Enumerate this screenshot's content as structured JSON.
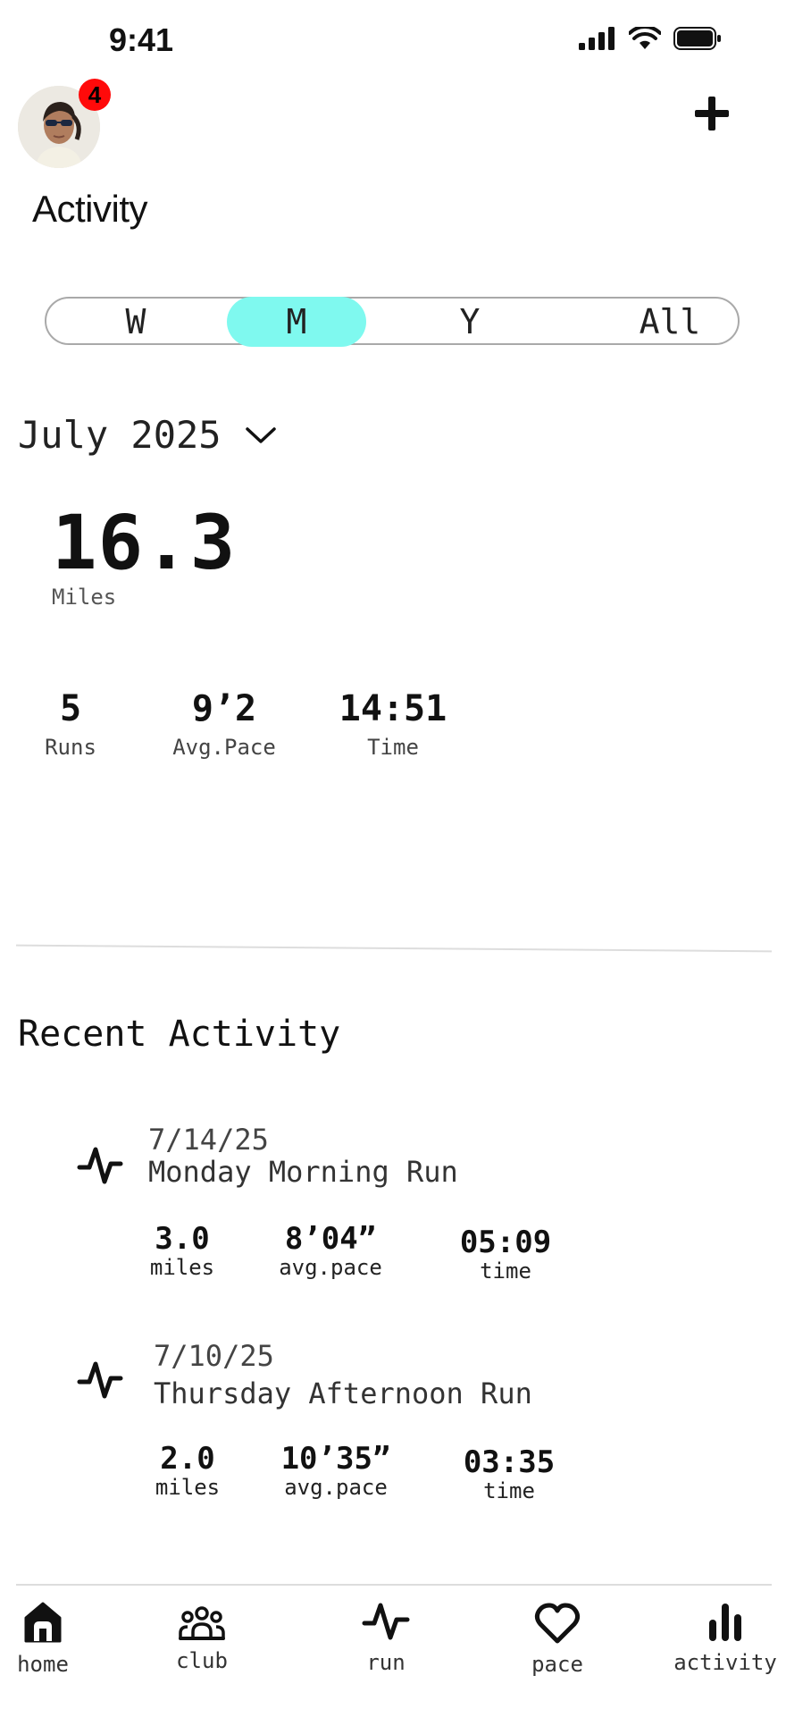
{
  "status": {
    "time": "9:41"
  },
  "header": {
    "badge_count": "4",
    "title": "Activity"
  },
  "segments": [
    {
      "label": "W",
      "selected": false
    },
    {
      "label": "M",
      "selected": true
    },
    {
      "label": "Y",
      "selected": false
    },
    {
      "label": "All",
      "selected": false
    }
  ],
  "period": {
    "label": "July 2025"
  },
  "summary": {
    "value": "16.3",
    "unit": "Miles",
    "stats": [
      {
        "value": "5",
        "label": "Runs"
      },
      {
        "value": "9’2",
        "label": "Avg.Pace"
      },
      {
        "value": "14:51",
        "label": "Time"
      }
    ]
  },
  "recent": {
    "heading": "Recent Activity",
    "items": [
      {
        "date": "7/14/25",
        "name": "Monday Morning Run",
        "miles": "3.0",
        "miles_label": "miles",
        "pace": "8’04”",
        "pace_label": "avg.pace",
        "time": "05:09",
        "time_label": "time"
      },
      {
        "date": "7/10/25",
        "name": "Thursday Afternoon Run",
        "miles": "2.0",
        "miles_label": "miles",
        "pace": "10’35”",
        "pace_label": "avg.pace",
        "time": "03:35",
        "time_label": "time"
      }
    ]
  },
  "nav": [
    {
      "label": "home",
      "icon": "home-icon"
    },
    {
      "label": "club",
      "icon": "group-icon"
    },
    {
      "label": "run",
      "icon": "pulse-icon"
    },
    {
      "label": "pace",
      "icon": "heart-icon"
    },
    {
      "label": "activity",
      "icon": "bar-chart-icon"
    }
  ],
  "colors": {
    "accent": "#7ff9ef",
    "badge": "#ff0a0a"
  }
}
